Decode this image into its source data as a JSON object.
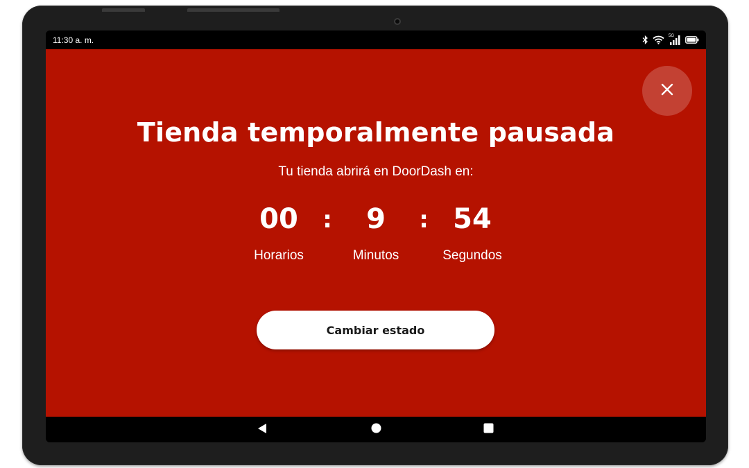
{
  "status_bar": {
    "time": "11:30 a. m.",
    "network_label": "5G",
    "icons": [
      "bluetooth-icon",
      "wifi-icon",
      "cellular-signal-icon",
      "battery-icon"
    ]
  },
  "dialog": {
    "title": "Tienda temporalmente pausada",
    "subtitle": "Tu tienda abrirá en DoorDash en:",
    "close_icon": "close-icon",
    "countdown": {
      "hours": {
        "value": "00",
        "label": "Horarios"
      },
      "minutes": {
        "value": "9",
        "label": "Minutos"
      },
      "seconds": {
        "value": "54",
        "label": "Segundos"
      },
      "separator": ":"
    },
    "action_label": "Cambiar estado"
  },
  "nav_bar": {
    "buttons": [
      "back-icon",
      "home-icon",
      "recents-icon"
    ]
  },
  "colors": {
    "background": "#b51200",
    "device_frame": "#1e1e1e",
    "button_bg": "#ffffff",
    "button_text": "#191919",
    "text": "#ffffff"
  }
}
